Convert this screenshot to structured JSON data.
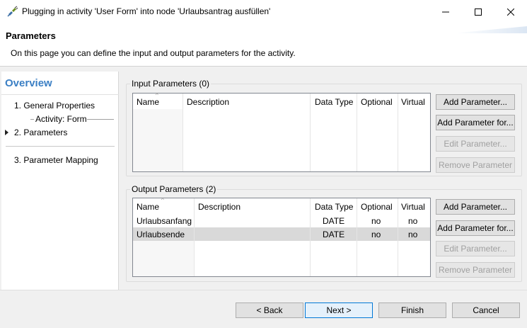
{
  "window": {
    "title": "Plugging in activity 'User Form' into node 'Urlaubsantrag ausfüllen'",
    "minimize_icon": "minimize-icon",
    "maximize_icon": "maximize-icon",
    "close_icon": "close-icon"
  },
  "header": {
    "title": "Parameters",
    "description": "On this page you can define the input and output parameters for the activity."
  },
  "nav": {
    "title": "Overview",
    "items": [
      {
        "label": "1. General Properties"
      },
      {
        "label": "Activity: Form"
      },
      {
        "label": "2. Parameters",
        "current": true
      },
      {
        "label": "3. Parameter Mapping"
      }
    ]
  },
  "input_params": {
    "label": "Input Parameters (0)",
    "columns": [
      "Name",
      "Description",
      "Data Type",
      "Optional",
      "Virtual"
    ],
    "rows": [],
    "buttons": {
      "add": "Add Parameter...",
      "add_for": "Add Parameter for...",
      "edit": "Edit Parameter...",
      "remove": "Remove Parameter"
    }
  },
  "output_params": {
    "label": "Output Parameters (2)",
    "columns": [
      "Name",
      "Description",
      "Data Type",
      "Optional",
      "Virtual"
    ],
    "rows": [
      {
        "name": "Urlaubsanfang",
        "description": "",
        "type": "DATE",
        "optional": "no",
        "virtual": "no"
      },
      {
        "name": "Urlaubsende",
        "description": "",
        "type": "DATE",
        "optional": "no",
        "virtual": "no"
      }
    ],
    "buttons": {
      "add": "Add Parameter...",
      "add_for": "Add Parameter for...",
      "edit": "Edit Parameter...",
      "remove": "Remove Parameter"
    }
  },
  "footer": {
    "back": "< Back",
    "next": "Next >",
    "finish": "Finish",
    "cancel": "Cancel"
  },
  "colors": {
    "accent": "#3b7fc4",
    "selected_row": "#d9d9d9",
    "default_button_border": "#0078d7"
  }
}
